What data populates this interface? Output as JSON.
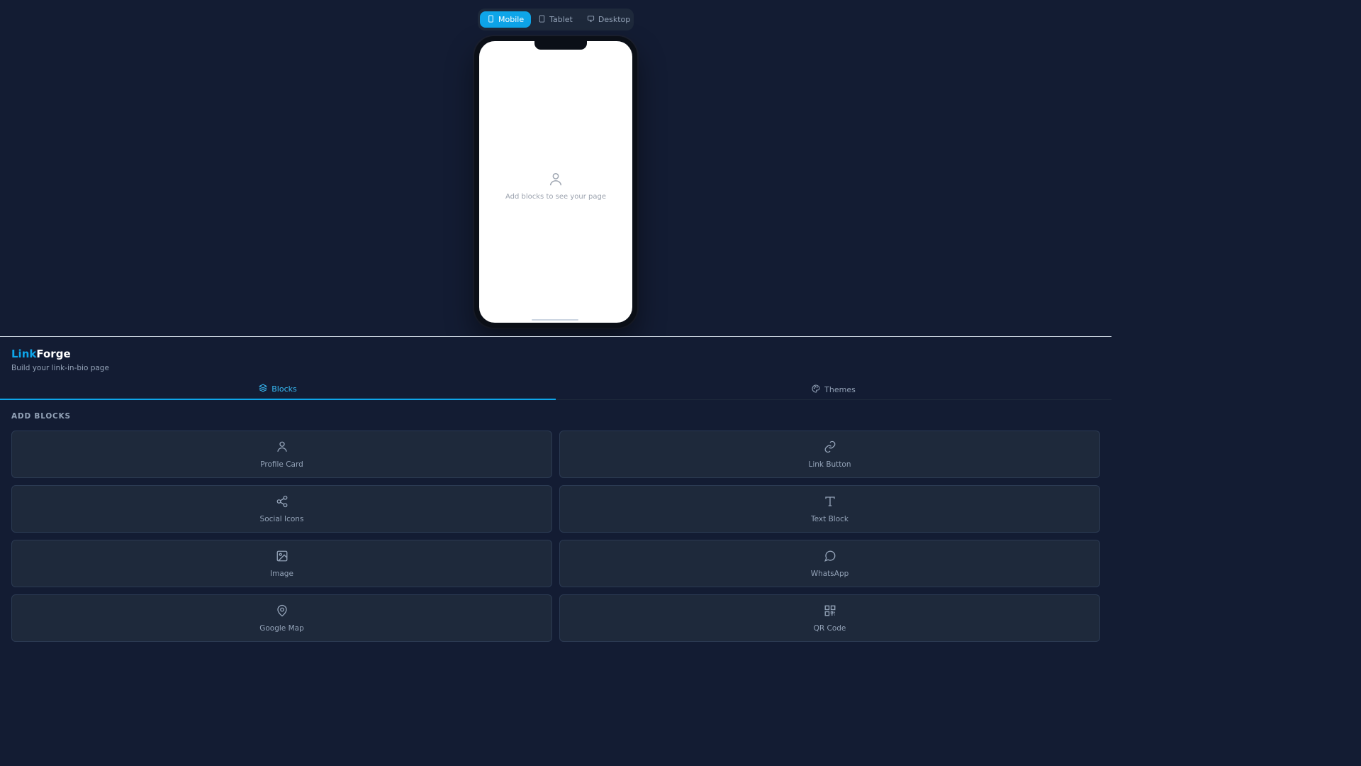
{
  "device_switch": {
    "options": [
      {
        "label": "Mobile",
        "icon": "smartphone-icon",
        "active": true
      },
      {
        "label": "Tablet",
        "icon": "tablet-icon",
        "active": false
      },
      {
        "label": "Desktop",
        "icon": "monitor-icon",
        "active": false
      }
    ]
  },
  "preview": {
    "empty_icon": "user-icon",
    "empty_text": "Add blocks to see your page"
  },
  "brand": {
    "name_accent": "Link",
    "name_rest": "Forge",
    "tagline": "Build your link-in-bio page"
  },
  "tabs": [
    {
      "label": "Blocks",
      "icon": "layers-icon",
      "active": true
    },
    {
      "label": "Themes",
      "icon": "palette-icon",
      "active": false
    }
  ],
  "section": {
    "title": "ADD BLOCKS"
  },
  "blocks": [
    {
      "label": "Profile Card",
      "icon": "user-icon"
    },
    {
      "label": "Link Button",
      "icon": "link-icon"
    },
    {
      "label": "Social Icons",
      "icon": "share-icon"
    },
    {
      "label": "Text Block",
      "icon": "type-icon"
    },
    {
      "label": "Image",
      "icon": "image-icon"
    },
    {
      "label": "WhatsApp",
      "icon": "message-circle-icon"
    },
    {
      "label": "Google Map",
      "icon": "map-pin-icon"
    },
    {
      "label": "QR Code",
      "icon": "qr-code-icon"
    }
  ],
  "colors": {
    "background": "#131c33",
    "card": "#1e293b",
    "accent": "#0ea5e9",
    "muted_text": "#94a3b8"
  }
}
